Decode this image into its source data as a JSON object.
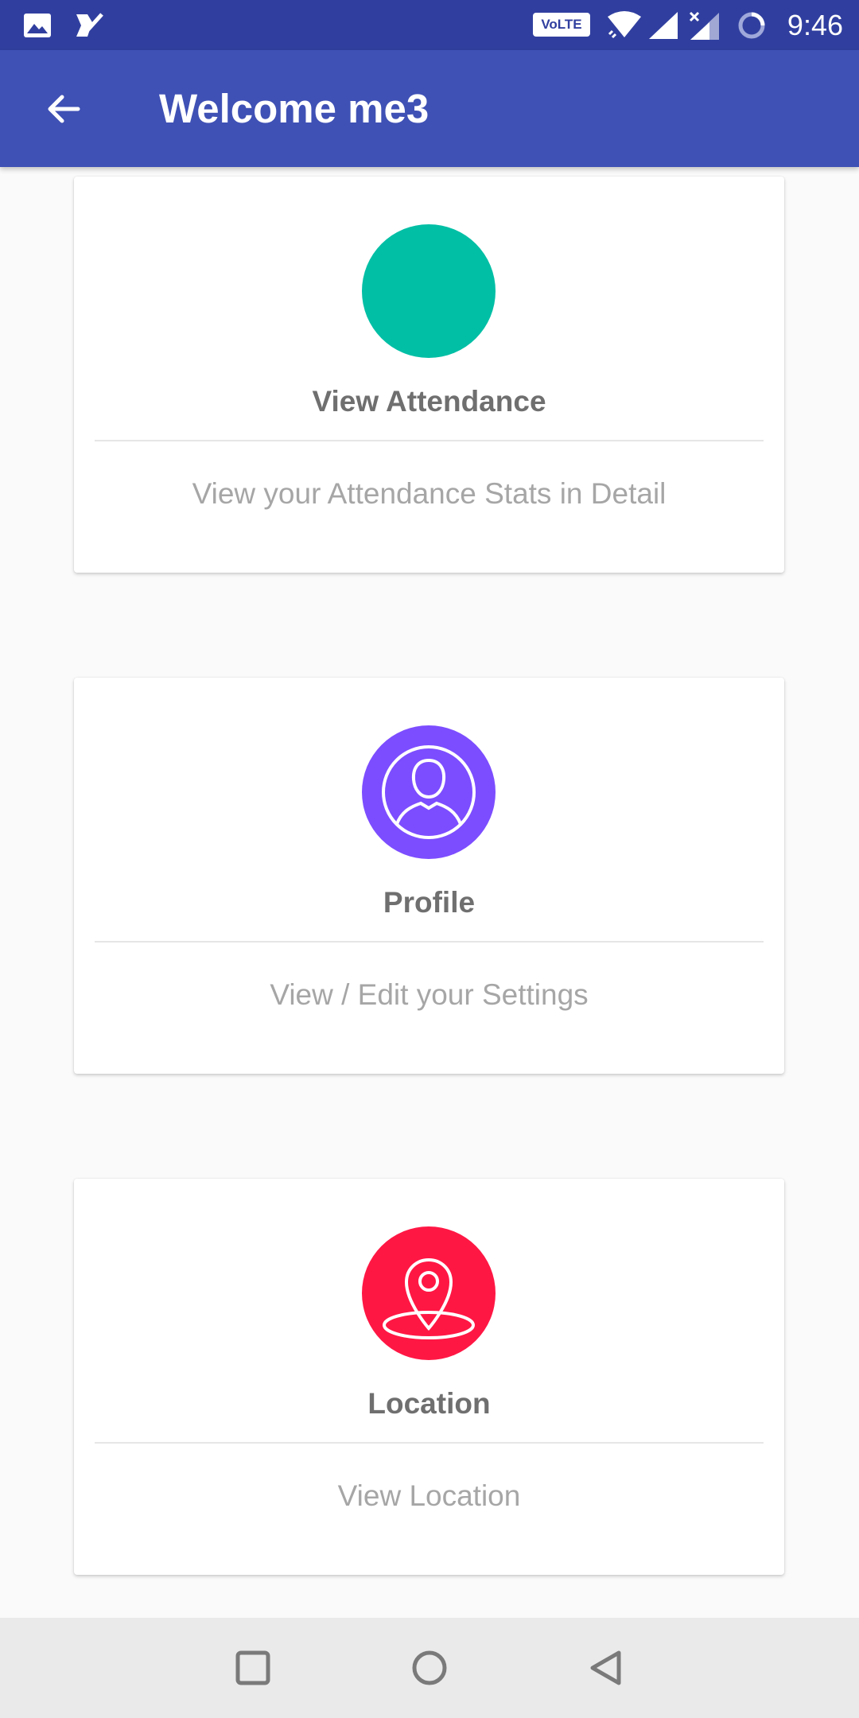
{
  "status_bar": {
    "time": "9:46",
    "volte_label": "VoLTE",
    "icons": [
      "image-icon",
      "check-task-icon",
      "wifi-icon",
      "signal-icon",
      "signal-no-data-icon",
      "loading-circle-icon"
    ]
  },
  "app_bar": {
    "title": "Welcome me3",
    "back_icon": "arrow-back-icon",
    "color": "#3F51B5"
  },
  "cards": [
    {
      "title": "View Attendance",
      "subtitle": "View your Attendance Stats in Detail",
      "icon": "attendance-circle-icon",
      "color": "#00BFA5"
    },
    {
      "title": "Profile",
      "subtitle": "View / Edit your Settings",
      "icon": "person-icon",
      "color": "#7C4DFF"
    },
    {
      "title": "Location",
      "subtitle": "View Location",
      "icon": "location-pin-icon",
      "color": "#FF1744"
    }
  ],
  "nav_bar": {
    "buttons": [
      "recents-square-icon",
      "home-circle-icon",
      "back-triangle-icon"
    ]
  }
}
